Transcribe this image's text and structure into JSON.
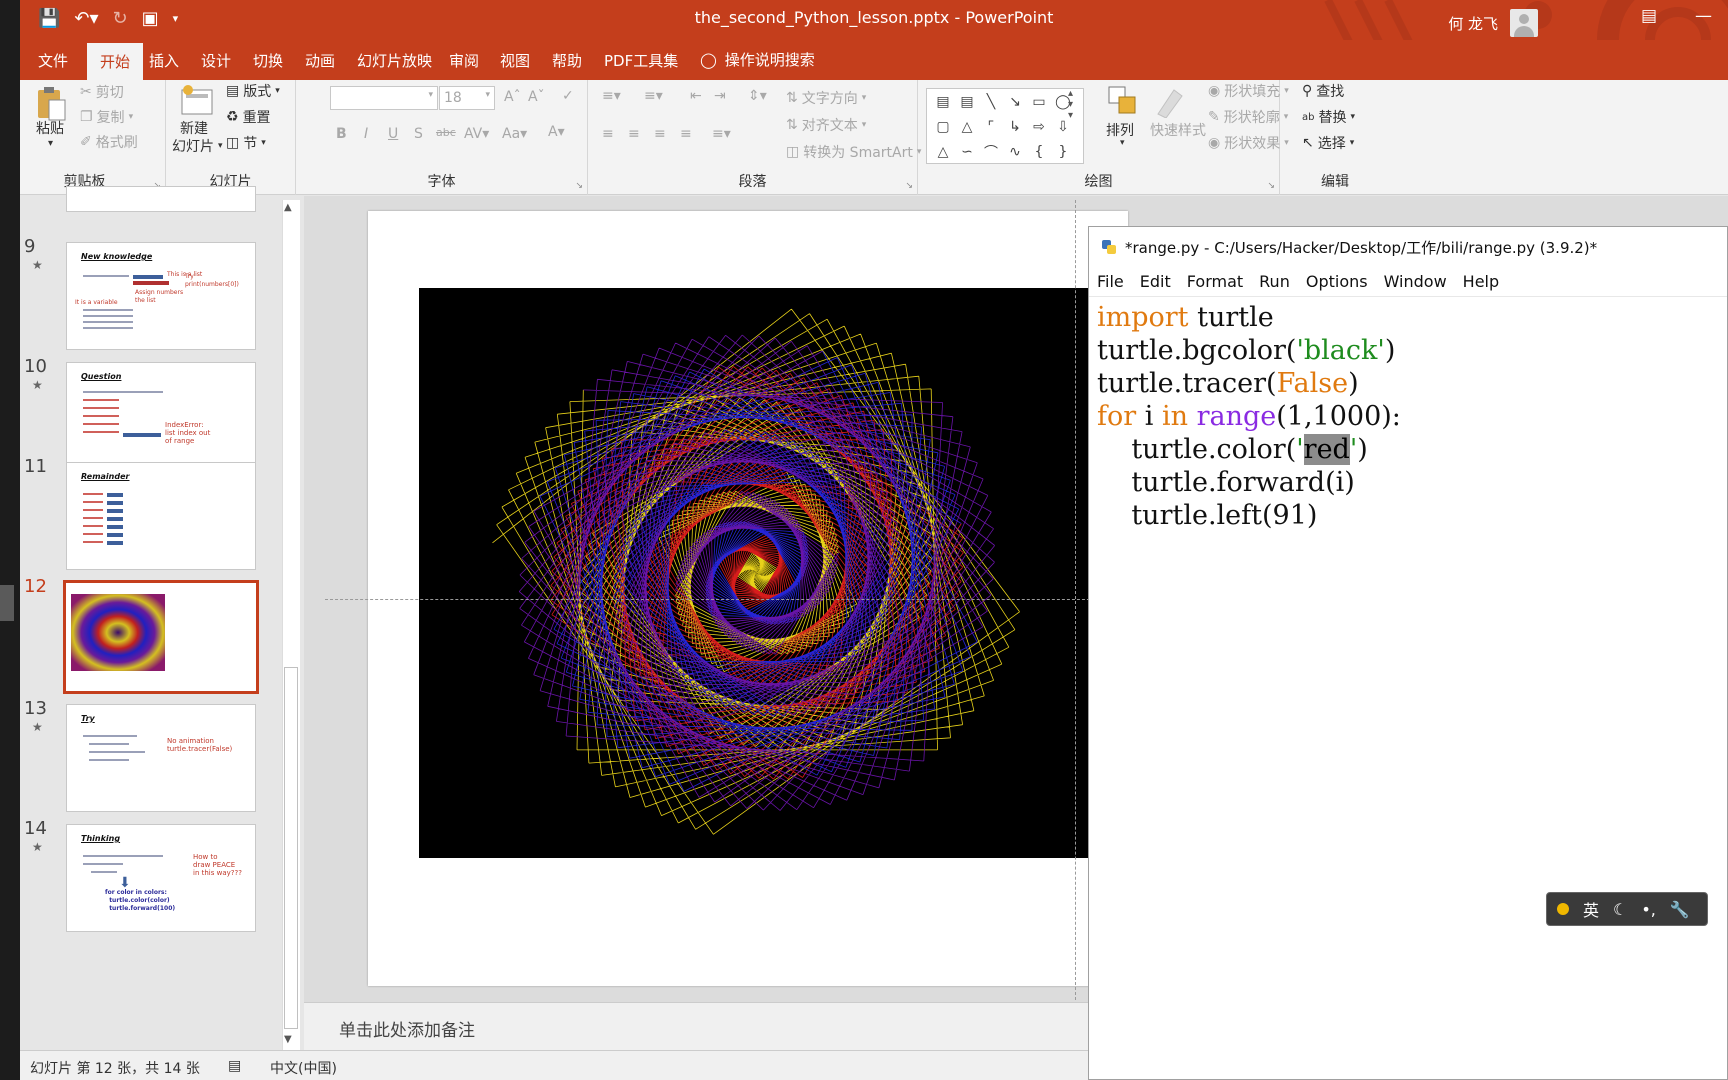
{
  "window": {
    "doc_title": "the_second_Python_lesson.pptx  -  PowerPoint",
    "user_name": "何 龙飞"
  },
  "tabs": [
    "文件",
    "开始",
    "插入",
    "设计",
    "切换",
    "动画",
    "幻灯片放映",
    "审阅",
    "视图",
    "帮助",
    "PDF工具集"
  ],
  "active_tab": "开始",
  "tell_me": "操作说明搜索",
  "ribbon": {
    "clipboard": {
      "label": "剪贴板",
      "paste": "粘贴",
      "cut": "剪切",
      "copy": "复制",
      "format_painter": "格式刷"
    },
    "slides": {
      "label": "幻灯片",
      "new_slide_1": "新建",
      "new_slide_2": "幻灯片",
      "layout": "版式",
      "reset": "重置",
      "section": "节"
    },
    "font": {
      "label": "字体",
      "size": "18"
    },
    "paragraph": {
      "label": "段落",
      "text_direction": "文字方向",
      "align_text": "对齐文本",
      "smartart": "转换为 SmartArt"
    },
    "drawing": {
      "label": "绘图",
      "arrange": "排列",
      "quick_styles": "快速样式",
      "shape_fill": "形状填充",
      "shape_outline": "形状轮廓",
      "shape_effects": "形状效果"
    },
    "editing": {
      "label": "编辑",
      "find": "查找",
      "replace": "替换",
      "select": "选择"
    }
  },
  "thumbnails": [
    {
      "num": "9",
      "title": "New knowledge",
      "notes": [
        "This is a list",
        "Try",
        "print(numbers[0])",
        "Assign numbers",
        "the list",
        "It is a variable"
      ]
    },
    {
      "num": "10",
      "title": "Question",
      "notes": [
        "IndexError:",
        "list index out",
        "of range"
      ]
    },
    {
      "num": "11",
      "title": "Remainder",
      "notes": []
    },
    {
      "num": "12",
      "title": "",
      "notes": []
    },
    {
      "num": "13",
      "title": "Try",
      "notes": [
        "No animation",
        "turtle.tracer(False)"
      ]
    },
    {
      "num": "14",
      "title": "Thinking",
      "notes": [
        "How to",
        "draw PEACE",
        "in this way???",
        "for color in colors:",
        "turtle.color(color)",
        "turtle.forward(100)"
      ]
    }
  ],
  "selected_slide": "12",
  "notes_placeholder": "单击此处添加备注",
  "status": {
    "slide_info": "幻灯片 第 12 张，共 14 张",
    "language": "中文(中国)"
  },
  "idle": {
    "title": "*range.py - C:/Users/Hacker/Desktop/工作/bili/range.py (3.9.2)*",
    "menu": [
      "File",
      "Edit",
      "Format",
      "Run",
      "Options",
      "Window",
      "Help"
    ],
    "code": {
      "l1_kw": "import",
      "l1_rest": " turtle",
      "l2_a": "turtle.bgcolor(",
      "l2_str": "'black'",
      "l2_b": ")",
      "l3_a": "turtle.tracer(",
      "l3_kw": "False",
      "l3_b": ")",
      "l4_for": "for",
      "l4_i": " i ",
      "l4_in": "in",
      "l4_range": "range",
      "l4_args": "(1,1000):",
      "l5_a": "    turtle.color(",
      "l5_q1": "'",
      "l5_sel": "red",
      "l5_q2": "'",
      "l5_b": ")",
      "l6": "    turtle.forward(i)",
      "l7": "    turtle.left(91)"
    }
  },
  "ime": {
    "lang": "英"
  }
}
